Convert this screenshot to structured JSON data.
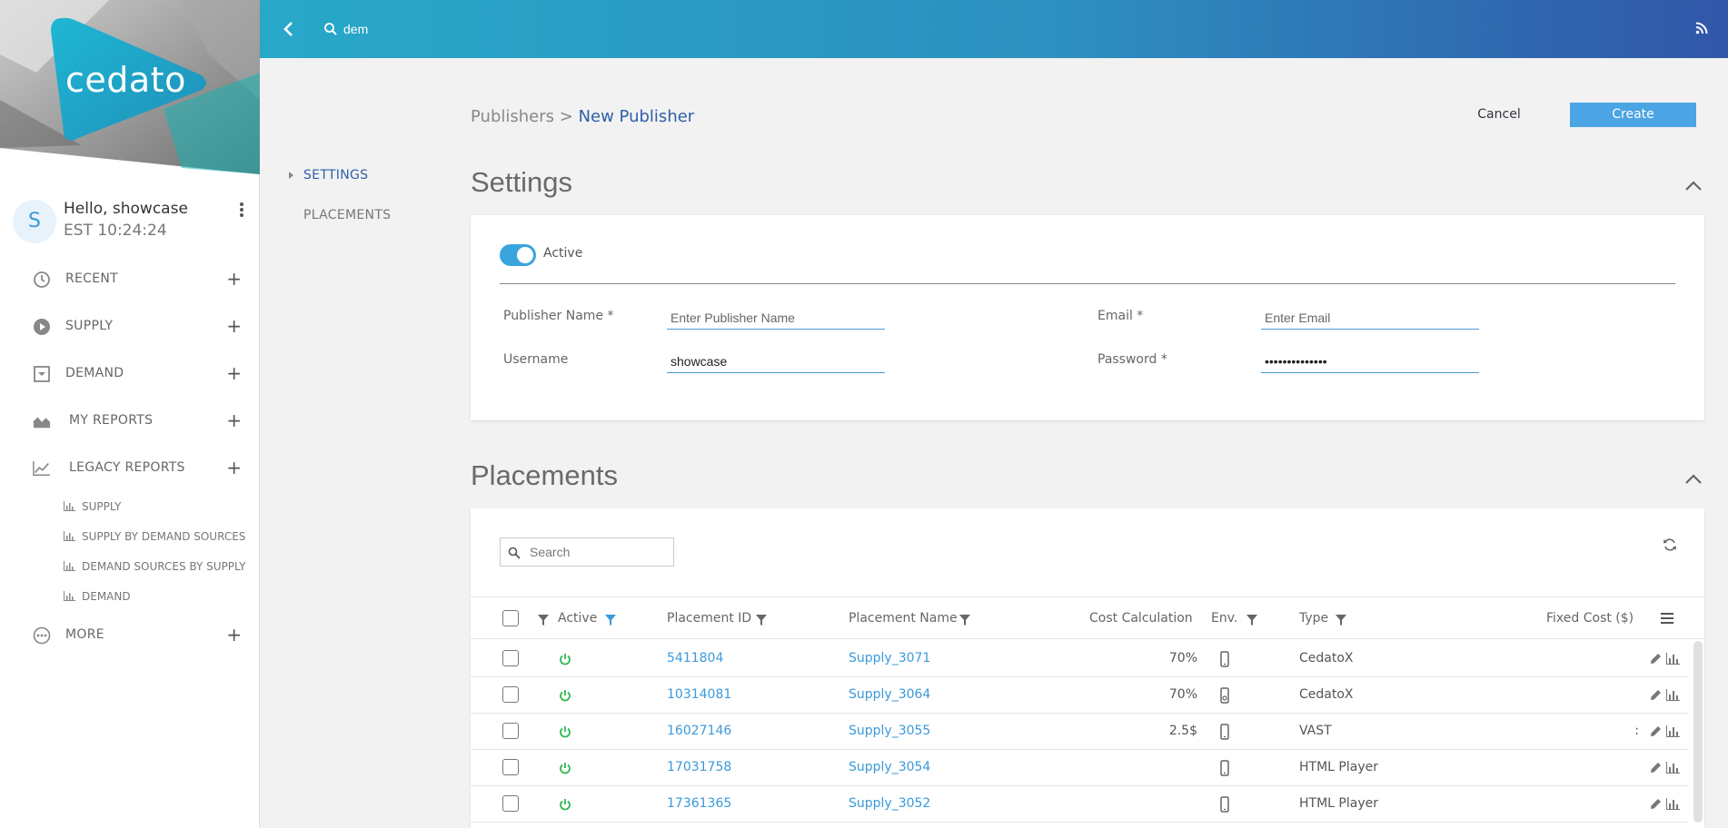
{
  "app": {
    "logo_text": "cedato",
    "colors": {
      "accent": "#3aa4dd",
      "primary_button": "#4ba4e3",
      "link": "#3a9ad9",
      "active_power": "#2eb84f",
      "breadcrumb_current": "#2f5ea8"
    }
  },
  "topbar": {
    "search_value": "dem",
    "icons": [
      "chevron-left-icon",
      "search-icon",
      "rss-icon"
    ]
  },
  "user": {
    "avatar_letter": "S",
    "greeting": "Hello, showcase",
    "clock": "EST 10:24:24"
  },
  "sidebar": {
    "items": [
      {
        "label": "RECENT",
        "icon": "clock-icon"
      },
      {
        "label": "SUPPLY",
        "icon": "play-circle-icon"
      },
      {
        "label": "DEMAND",
        "icon": "inbox-icon"
      },
      {
        "label": "MY REPORTS",
        "icon": "area-chart-icon"
      },
      {
        "label": "LEGACY REPORTS",
        "icon": "line-chart-icon"
      },
      {
        "label": "MORE",
        "icon": "more-circle-icon"
      }
    ],
    "legacy_sub": [
      {
        "label": "SUPPLY"
      },
      {
        "label": "SUPPLY BY DEMAND SOURCES"
      },
      {
        "label": "DEMAND SOURCES BY SUPPLY"
      },
      {
        "label": "DEMAND"
      }
    ]
  },
  "section_nav": {
    "settings": "SETTINGS",
    "placements": "PLACEMENTS"
  },
  "breadcrumb": {
    "parent": "Publishers",
    "separator": ">",
    "current": "New Publisher"
  },
  "actions": {
    "cancel": "Cancel",
    "create": "Create"
  },
  "settings": {
    "title": "Settings",
    "active_label": "Active",
    "active": true,
    "publisher_name_label": "Publisher Name *",
    "publisher_name_placeholder": "Enter Publisher Name",
    "email_label": "Email *",
    "email_placeholder": "Enter Email",
    "username_label": "Username",
    "username_value": "showcase",
    "password_label": "Password *",
    "password_value": "••••••••••••••"
  },
  "placements": {
    "title": "Placements",
    "search_placeholder": "Search",
    "columns": {
      "active": "Active",
      "placement_id": "Placement ID",
      "placement_name": "Placement Name",
      "cost_calculation": "Cost Calculation",
      "env": "Env.",
      "type": "Type",
      "fixed_cost": "Fixed Cost ($)"
    },
    "rows": [
      {
        "id": "5411804",
        "name": "Supply_3071",
        "cost": "70%",
        "env": "mobile-icon",
        "type": "CedatoX",
        "fixed": ""
      },
      {
        "id": "10314081",
        "name": "Supply_3064",
        "cost": "70%",
        "env": "mobile-app-icon",
        "type": "CedatoX",
        "fixed": ""
      },
      {
        "id": "16027146",
        "name": "Supply_3055",
        "cost": "2.5$",
        "env": "mobile-icon",
        "type": "VAST",
        "fixed": ":"
      },
      {
        "id": "17031758",
        "name": "Supply_3054",
        "cost": "",
        "env": "mobile-icon",
        "type": "HTML Player",
        "fixed": ""
      },
      {
        "id": "17361365",
        "name": "Supply_3052",
        "cost": "",
        "env": "mobile-icon",
        "type": "HTML Player",
        "fixed": ""
      }
    ]
  }
}
